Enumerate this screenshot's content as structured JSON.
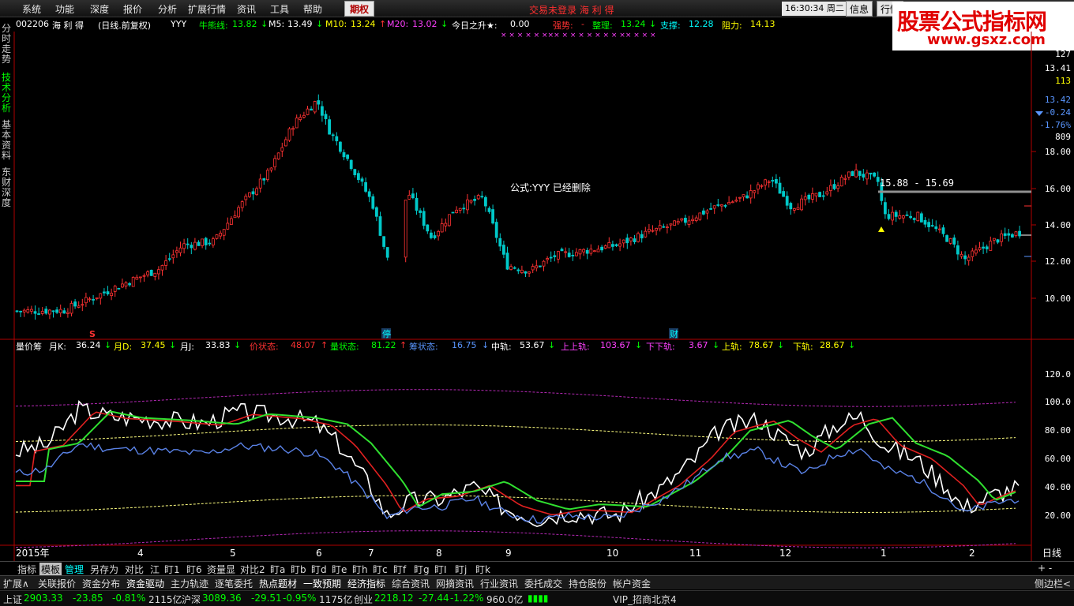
{
  "menu": {
    "items": [
      "系统",
      "功能",
      "深度",
      "报价",
      "分析",
      "扩展行情",
      "资讯",
      "工具",
      "帮助"
    ],
    "qiquan": "期权",
    "center_title": "交易未登录  海 利 得",
    "clock": "16:30:34 周二",
    "info_btn": "信息",
    "quote_btn": "行情"
  },
  "logo": {
    "text": "股票公式指标网",
    "url": "www.gsxz.com"
  },
  "sidebar": {
    "tabs": [
      "分时走势",
      "技术分析",
      "基本资料",
      "东财深度"
    ]
  },
  "header": {
    "code": "002206",
    "name": "海 利 得",
    "period": "(日线.前复权)",
    "formula": "YYY",
    "bull_label": "牛熊线:",
    "bull_value": "13.82",
    "m5_label": "M5:",
    "m5_value": "13.49",
    "m10_label": "M10:",
    "m10_value": "13.24",
    "m20_label": "M20:",
    "m20_value": "13.02",
    "rise_label": "今日之升★:",
    "rise_value": "0.00",
    "strong_label": "强势:",
    "strong_value": "-",
    "adjust_label": "整理:",
    "adjust_value": "13.24",
    "support_label": "支撑:",
    "support_value": "12.28",
    "resist_label": "阻力:",
    "resist_value": "14.13"
  },
  "price_axis": {
    "labels": [
      "18.00",
      "16.00",
      "14.00",
      "12.00",
      "10.00"
    ],
    "info": [
      "127",
      "13.41",
      "113",
      "13.42",
      "-0.24",
      "-1.76%",
      "809"
    ]
  },
  "notice": "公式:YYY 已经删除",
  "range_label": "15.88 - 15.69",
  "chart_marks": {
    "s": "S",
    "ting": "停",
    "cai": "财"
  },
  "indicator_header": {
    "name": "量价筹",
    "k_label": "月K:",
    "k_value": "36.24",
    "d_label": "月D:",
    "d_value": "37.45",
    "j_label": "月J:",
    "j_value": "33.83",
    "price_state_label": "价状态:",
    "price_state_value": "48.07",
    "vol_state_label": "量状态:",
    "vol_state_value": "81.22",
    "chip_state_label": "筹状态:",
    "chip_state_value": "16.75",
    "mid_label": "中轨:",
    "mid_value": "53.67",
    "uu_label": "上上轨:",
    "uu_value": "103.67",
    "dd_label": "下下轨:",
    "dd_value": "3.67",
    "up_label": "上轨:",
    "up_value": "78.67",
    "down_label": "下轨:",
    "down_value": "28.67"
  },
  "indicator_axis": {
    "labels": [
      "120.0",
      "100.0",
      "80.00",
      "60.00",
      "40.00",
      "20.00"
    ]
  },
  "x_axis": {
    "labels": [
      "2015年",
      "4",
      "5",
      "6",
      "7",
      "8",
      "9",
      "10",
      "11",
      "12",
      "1",
      "2"
    ],
    "period": "日线"
  },
  "bottom_tabs": [
    "指标",
    "模板",
    "管理",
    "另存为",
    "对比",
    "江",
    "盯1",
    "盯6",
    "资量显",
    "对比2",
    "盯a",
    "盯b",
    "盯d",
    "盯e",
    "盯h",
    "盯c",
    "盯f",
    "盯g",
    "盯I",
    "盯j",
    "盯k"
  ],
  "bottom_right": "+ -",
  "func_bar": [
    "扩展∧",
    "关联报价",
    "资金分布",
    "资金驱动",
    "主力轨迹",
    "逐笔委托",
    "热点题材",
    "一致预期",
    "经济指标",
    "综合资讯",
    "网摘资讯",
    "行业资讯",
    "委托成交",
    "持仓股份",
    "帐户资金"
  ],
  "func_bar_right": "侧边栏<",
  "status": {
    "sh_label": "上证",
    "sh_value": "2903.33",
    "sh_chg": "-23.85",
    "sh_pct": "-0.81%",
    "sh_amt": "2115亿",
    "sz_label": "沪深",
    "sz_value": "3089.36",
    "sz_chg": "-29.51",
    "sz_pct": "-0.95%",
    "sz_amt": "1175亿",
    "cy_label": "创业",
    "cy_value": "2218.12",
    "cy_chg": "-27.44",
    "cy_pct": "-1.22%",
    "cy_amt": "960.0亿",
    "vip": "VIP_招商北京4"
  },
  "colors": {
    "up": "#ff3232",
    "down": "#00e600",
    "axis": "#b00000",
    "k_line": "#ffffff",
    "chip": "#5a82e6",
    "band_outer": "#b428b4",
    "band_inner": "#ffff80"
  }
}
